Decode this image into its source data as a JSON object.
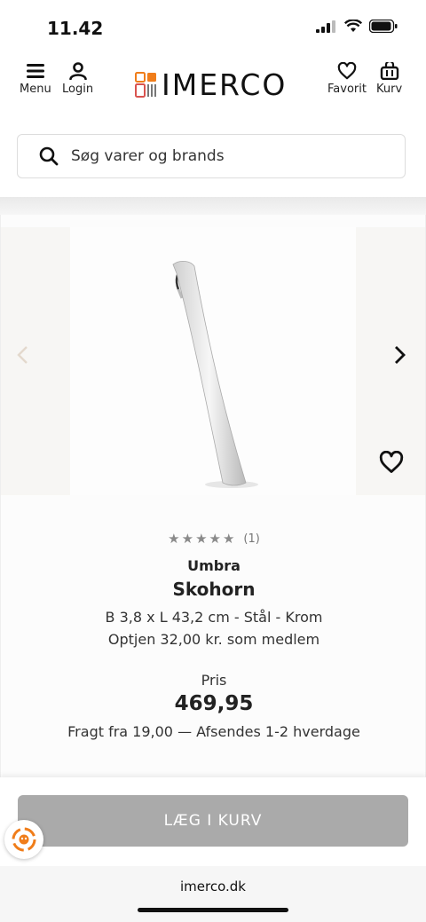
{
  "status_bar": {
    "time": "11.42"
  },
  "header": {
    "menu_label": "Menu",
    "login_label": "Login",
    "logo_text": "IMERCO",
    "favorite_label": "Favorit",
    "cart_label": "Kurv"
  },
  "search": {
    "placeholder": "Søg varer og brands"
  },
  "product": {
    "rating_count": "(1)",
    "rating_stars": 5,
    "brand": "Umbra",
    "name": "Skohorn",
    "dimensions": "B 3,8 x L 43,2 cm - Stål - Krom",
    "member_earn": "Optjen 32,00 kr. som medlem",
    "price_label": "Pris",
    "price": "469,95",
    "shipping": "Fragt fra 19,00 — Afsendes 1-2 hverdage"
  },
  "cart_button": {
    "label": "LÆG I KURV"
  },
  "browser": {
    "domain": "imerco.dk"
  },
  "colors": {
    "logo_orange": "#f07d1a",
    "button_disabled": "#aaaaaa",
    "star": "#8a8a8a"
  }
}
